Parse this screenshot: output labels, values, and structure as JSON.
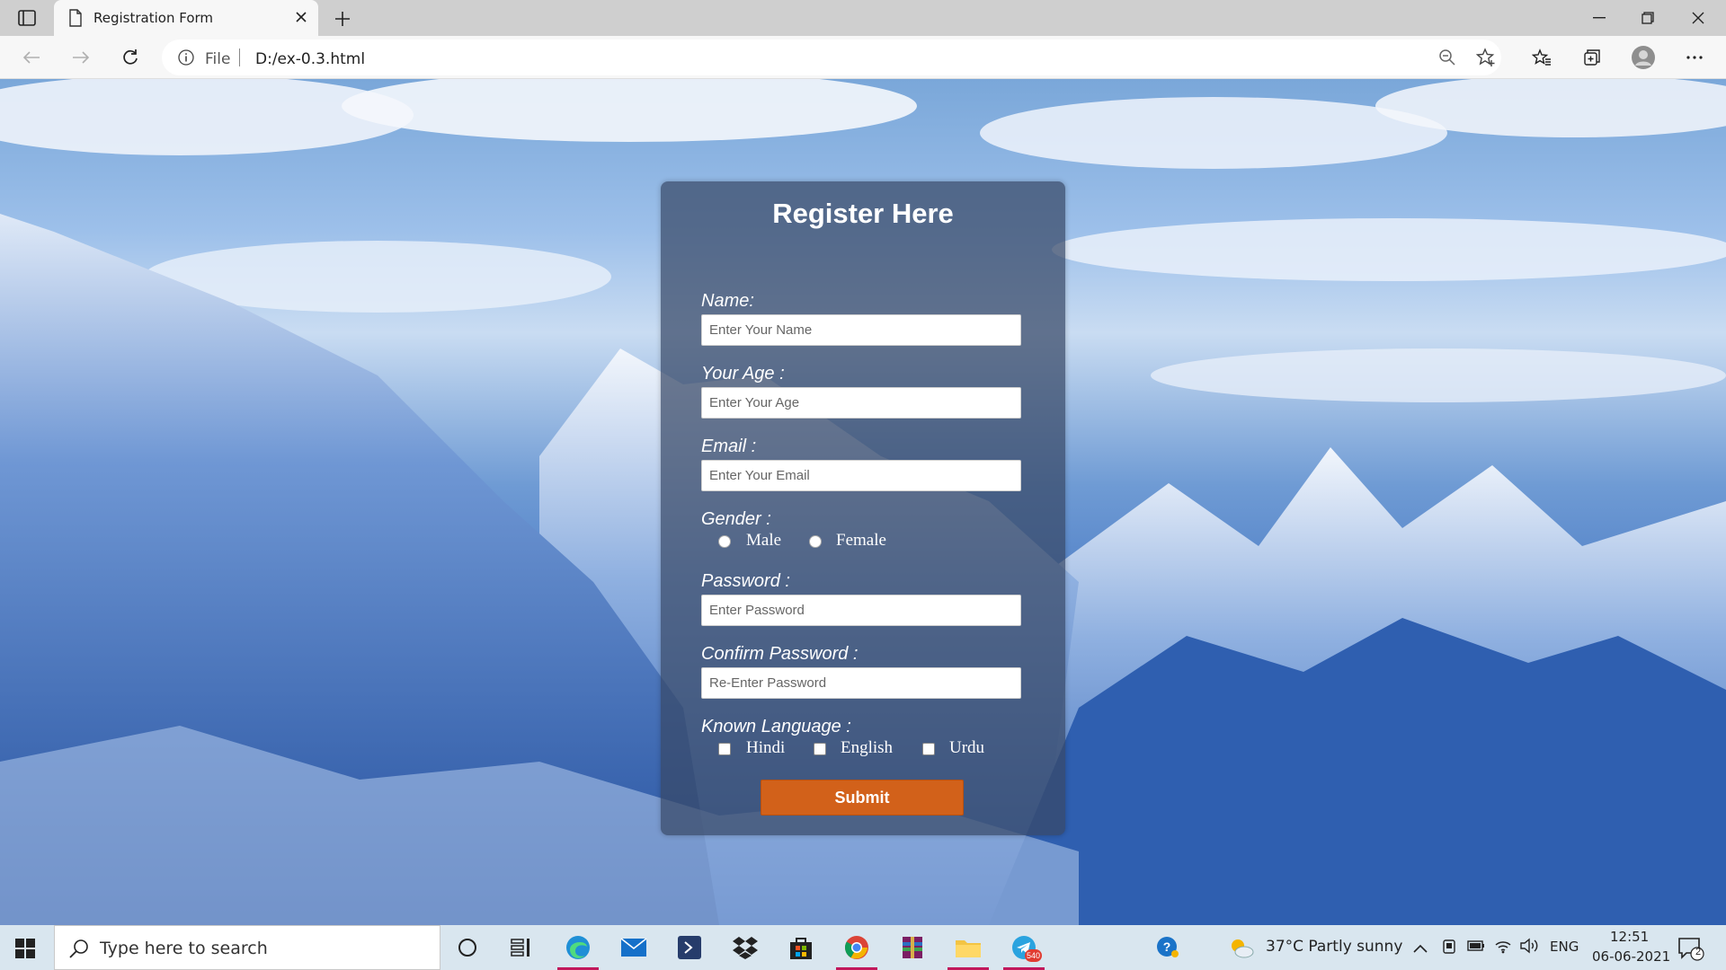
{
  "browser": {
    "tab_title": "Registration Form",
    "address_scheme": "File",
    "address_url": "D:/ex-0.3.html"
  },
  "form": {
    "title": "Register Here",
    "name_label": "Name:",
    "name_placeholder": "Enter Your Name",
    "age_label": "Your Age :",
    "age_placeholder": "Enter Your Age",
    "email_label": "Email :",
    "email_placeholder": "Enter Your Email",
    "gender_label": "Gender :",
    "gender_options": [
      "Male",
      "Female"
    ],
    "password_label": "Password :",
    "password_placeholder": "Enter Password",
    "confirm_label": "Confirm Password :",
    "confirm_placeholder": "Re-Enter Password",
    "language_label": "Known Language :",
    "language_options": [
      "Hindi",
      "English",
      "Urdu"
    ],
    "submit_label": "Submit"
  },
  "taskbar": {
    "search_placeholder": "Type here to search",
    "weather": "37°C  Partly sunny",
    "language": "ENG",
    "time": "12:51",
    "date": "06-06-2021",
    "notification_count": "2",
    "telegram_badge": "540"
  },
  "colors": {
    "card_bg": "rgba(55,72,102,0.72)",
    "submit_bg": "#d2611a",
    "taskbar_bg": "#d9e6ef"
  }
}
